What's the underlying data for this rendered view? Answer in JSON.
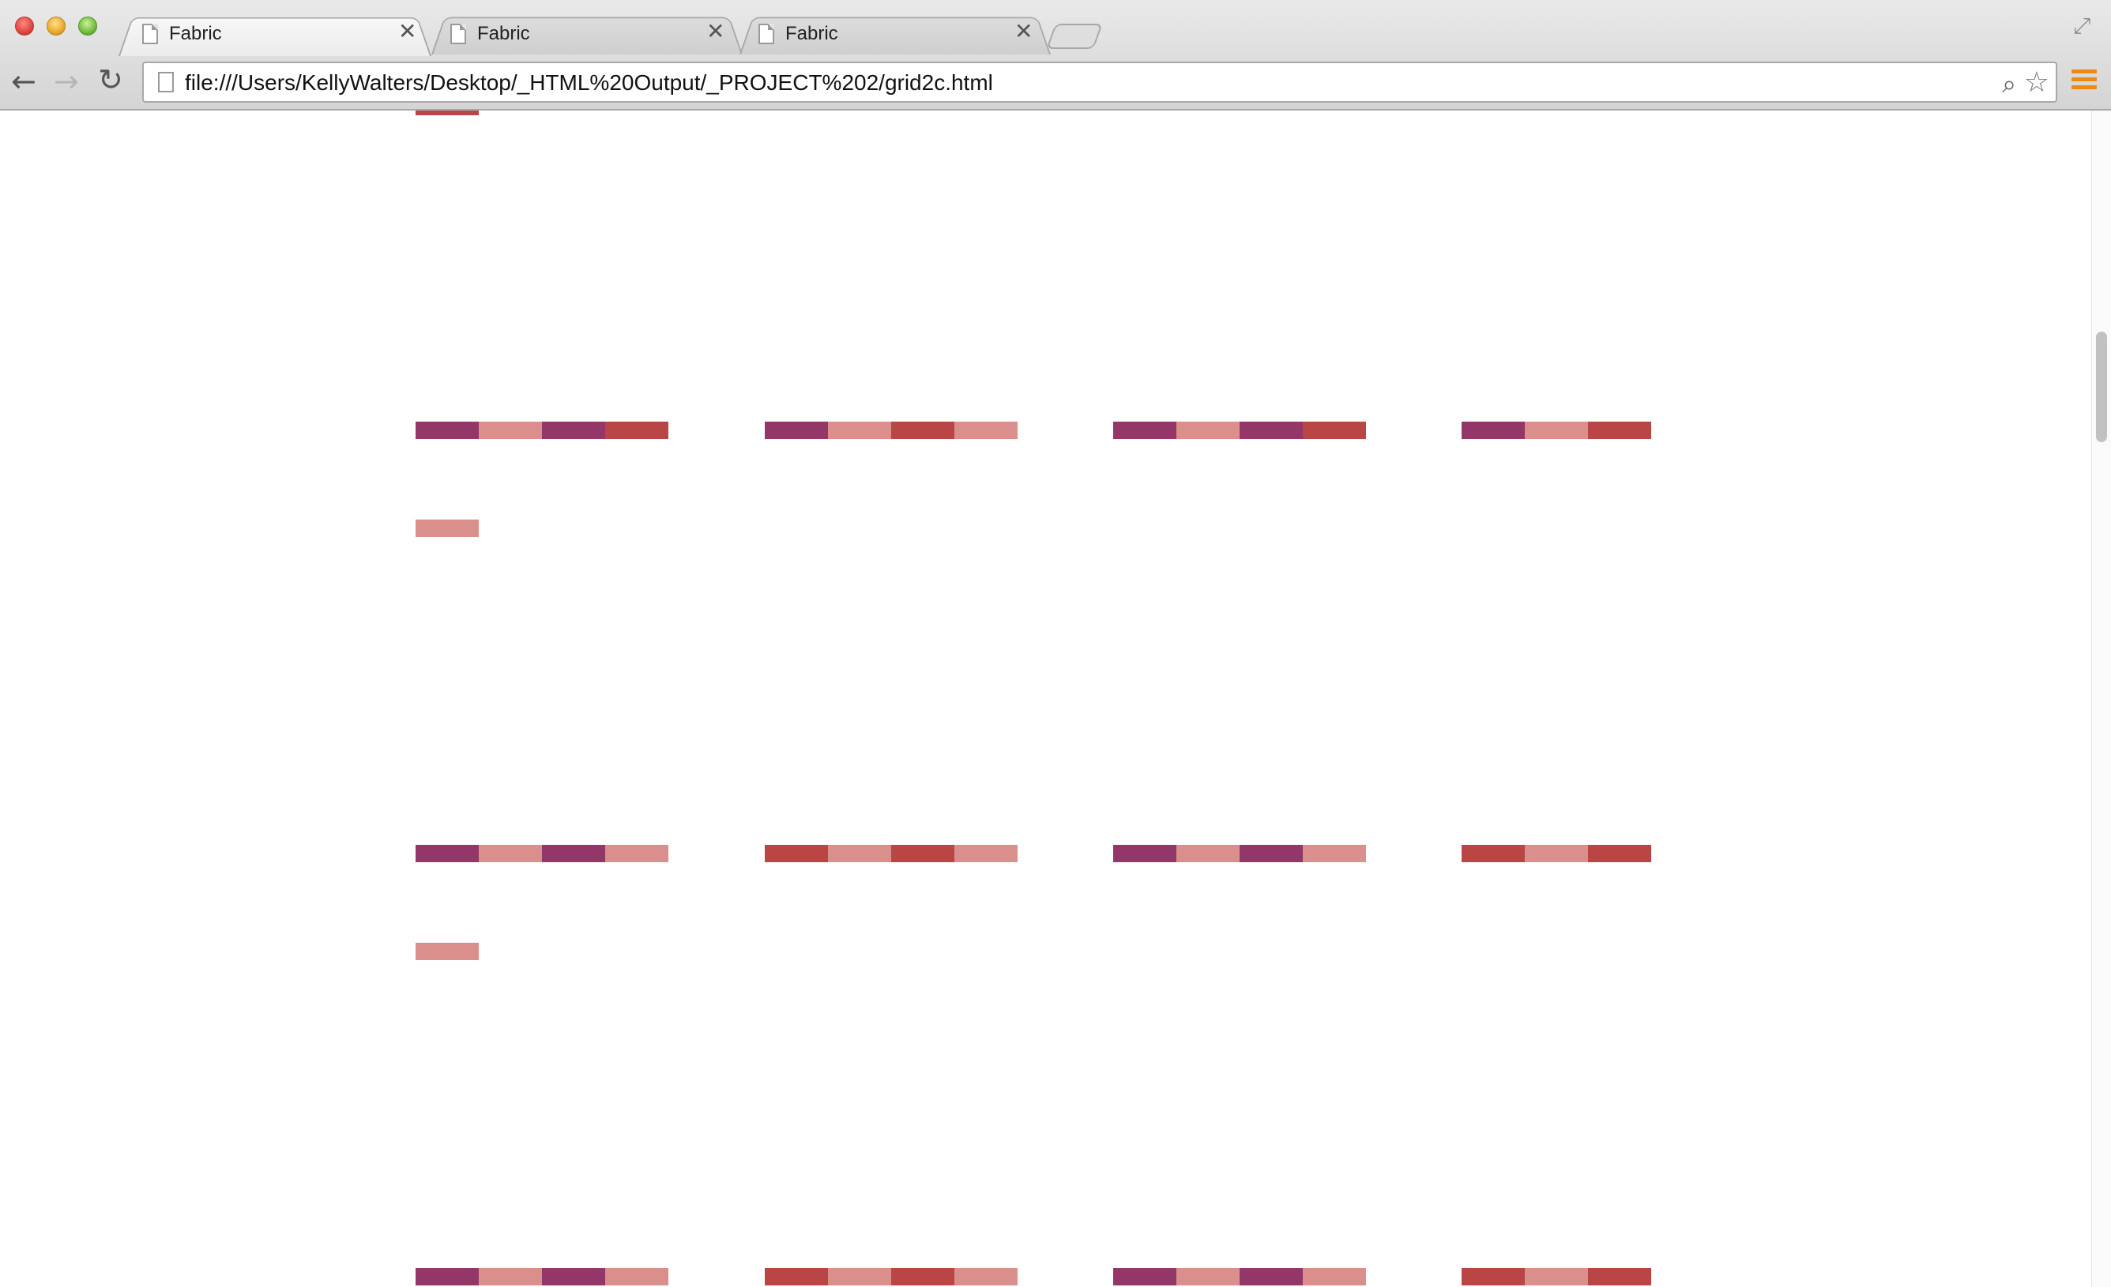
{
  "browser": {
    "tabs": [
      {
        "title": "Fabric",
        "active": true
      },
      {
        "title": "Fabric",
        "active": false
      },
      {
        "title": "Fabric",
        "active": false
      }
    ],
    "url": "file:///Users/KellyWalters/Desktop/_HTML%20Output/_PROJECT%202/grid2c.html",
    "close_glyph": "✕",
    "icons": {
      "back": "back-arrow-icon",
      "forward": "forward-arrow-icon",
      "reload": "reload-icon",
      "zoom": "zoom-icon",
      "bookmark": "star-icon",
      "menu": "hamburger-menu-icon",
      "fullscreen": "fullscreen-icon"
    }
  },
  "palette": {
    "plum": "#933768",
    "pink": "#db8f8c",
    "red": "#b94645"
  },
  "grid": {
    "rows": [
      {
        "groups": [
          [
            "plum",
            "pink",
            "plum",
            "red"
          ],
          [
            "plum",
            "pink",
            "red",
            "pink"
          ],
          [
            "plum",
            "pink",
            "plum",
            "red"
          ],
          [
            "plum",
            "pink",
            "red"
          ]
        ],
        "extra": "pink"
      },
      {
        "groups": [
          [
            "plum",
            "pink",
            "plum",
            "pink"
          ],
          [
            "red",
            "pink",
            "red",
            "pink"
          ],
          [
            "plum",
            "pink",
            "plum",
            "pink"
          ],
          [
            "red",
            "pink",
            "red"
          ]
        ],
        "extra": "pink"
      },
      {
        "groups": [
          [
            "plum",
            "pink",
            "plum",
            "pink"
          ],
          [
            "red",
            "pink",
            "red",
            "pink"
          ],
          [
            "plum",
            "pink",
            "plum",
            "pink"
          ],
          [
            "red",
            "pink",
            "red"
          ]
        ],
        "extra": null
      }
    ],
    "top_partial": "red"
  }
}
